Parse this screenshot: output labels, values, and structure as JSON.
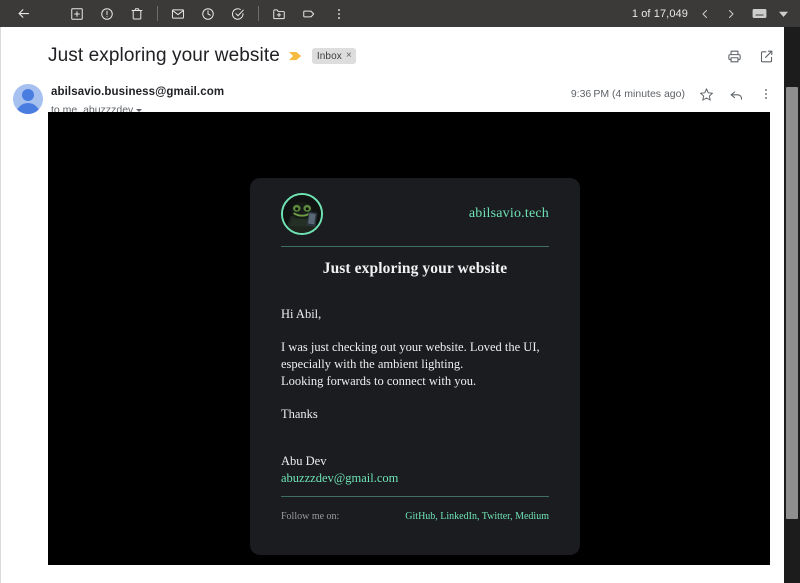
{
  "toolbar": {
    "back_label": "Back",
    "icons": [
      {
        "name": "back-arrow-icon",
        "label": "Back to Inbox"
      },
      {
        "name": "archive-icon",
        "label": "Archive"
      },
      {
        "name": "report-spam-icon",
        "label": "Report spam"
      },
      {
        "name": "delete-icon",
        "label": "Delete"
      },
      {
        "name": "mark-unread-icon",
        "label": "Mark as unread"
      },
      {
        "name": "snooze-icon",
        "label": "Snooze"
      },
      {
        "name": "add-to-tasks-icon",
        "label": "Add to tasks"
      },
      {
        "name": "move-to-icon",
        "label": "Move to"
      },
      {
        "name": "labels-icon",
        "label": "Labels"
      },
      {
        "name": "more-options-icon",
        "label": "More"
      }
    ],
    "counter": "1 of 17,049",
    "prev_label": "Newer",
    "next_label": "Older",
    "input_tools_label": "Input tools"
  },
  "message": {
    "subject": "Just exploring your website",
    "importance_marker": "important-marker-icon",
    "label_chip": "Inbox",
    "label_chip_remove": "×",
    "print_label": "Print all",
    "popout_label": "Open in new window",
    "sender_email": "abilsavio.business@gmail.com",
    "recipients": "to me, abuzzzdev",
    "timestamp": "9:36 PM (4 minutes ago)",
    "star_label": "Star",
    "reply_label": "Reply",
    "more_label": "More"
  },
  "card": {
    "brand_avatar_name": "frog-laptop-avatar",
    "brand_domain": "abilsavio.tech",
    "title": "Just exploring your website",
    "greeting": "Hi Abil,",
    "paragraph_line1": "I was just checking out your website. Loved the UI,",
    "paragraph_line2": "especially with the ambient lighting.",
    "paragraph_line3": "Looking forwards to connect with you.",
    "closing": "Thanks",
    "signature_name": "Abu Dev",
    "signature_email": "abuzzzdev@gmail.com",
    "footer_label": "Follow me on:",
    "footer_links": "GitHub, LinkedIn, Twitter, Medium"
  },
  "colors": {
    "toolbar_bg": "#3b3a38",
    "email_bg": "#000000",
    "card_bg": "#1a1c20",
    "accent_mint": "#6fe3b4",
    "divider_teal": "#3f6e63",
    "chip_bg": "#ddddde",
    "importance_yellow": "#f5bb41"
  }
}
